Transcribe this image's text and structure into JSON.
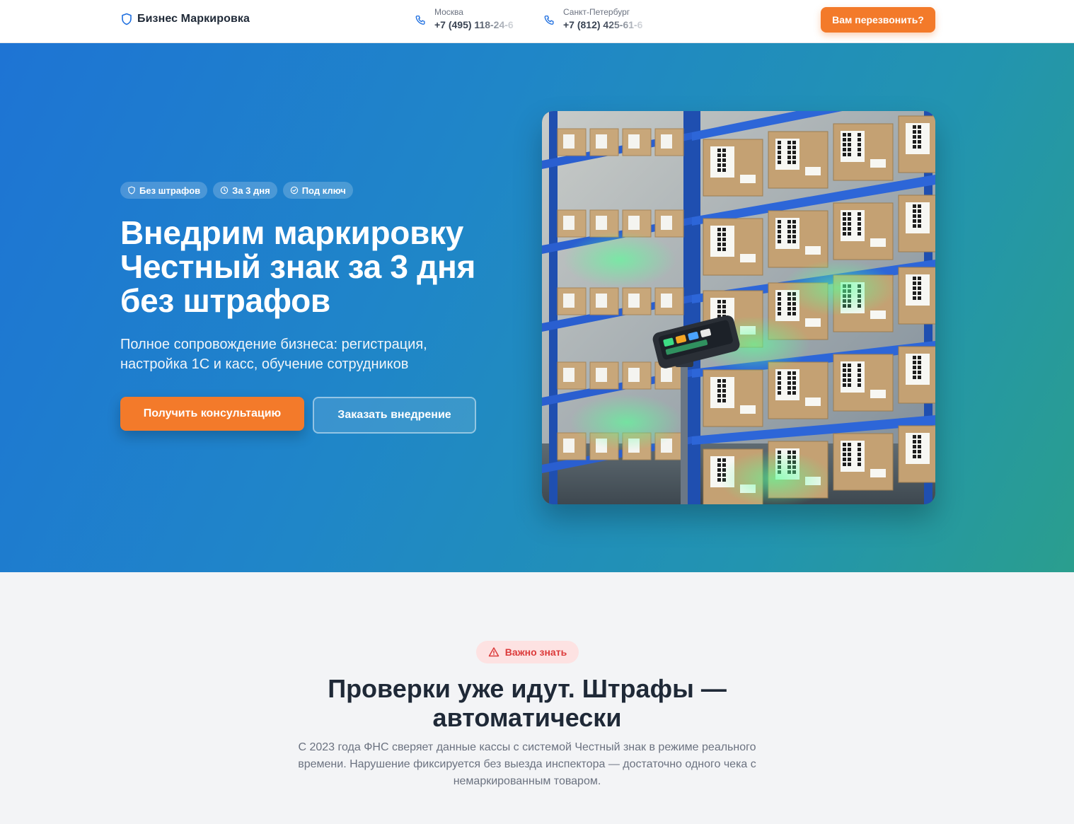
{
  "header": {
    "logo_text": "Бизнес Маркировка",
    "phones": [
      {
        "city": "Москва",
        "number": "+7 (495) 118-24-6"
      },
      {
        "city": "Санкт-Петербург",
        "number": "+7 (812) 425-61-6"
      }
    ],
    "callback_label": "Вам перезвонить?"
  },
  "hero": {
    "badges": [
      {
        "label": "Без штрафов",
        "icon": "shield-icon"
      },
      {
        "label": "За 3 дня",
        "icon": "clock-icon"
      },
      {
        "label": "Под ключ",
        "icon": "check-circle-icon"
      }
    ],
    "title": "Внедрим маркировку Честный знак за 3 дня без штрафов",
    "subtitle": "Полное сопровождение бизнеса: регистрация, настройка 1С и касс, обучение сотрудников",
    "primary_button": "Получить консультацию",
    "secondary_button": "Заказать внедрение"
  },
  "important": {
    "pill_label": "Важно знать",
    "title": "Проверки уже идут. Штрафы — автоматически",
    "text": "С 2023 года ФНС сверяет данные кассы с системой Честный знак в режиме реального времени. Нарушение фиксируется без выезда инспектора — достаточно одного чека с немаркированным товаром."
  },
  "colors": {
    "accent_orange": "#f37a2a",
    "hero_gradient_start": "#1e74d4",
    "hero_gradient_end": "#2a9e8e",
    "warning_red": "#dc3b3b"
  }
}
